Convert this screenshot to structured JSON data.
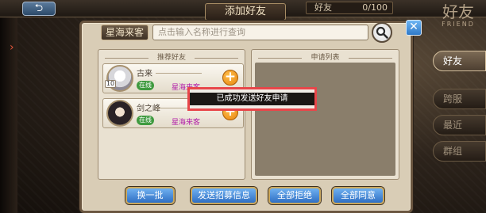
{
  "header": {
    "back_icon": "back-arrow-icon",
    "title": "添加好友",
    "friend_count_label": "好友",
    "friend_count_value": "0/100",
    "brand_cn": "好友",
    "brand_en": "FRIEND"
  },
  "side_tabs": [
    {
      "label": "好友"
    },
    {
      "label": "跨服"
    },
    {
      "label": "最近"
    },
    {
      "label": "群组"
    }
  ],
  "search": {
    "server_label": "星海来客",
    "placeholder": "点击输入名称进行查询"
  },
  "recommend_panel": {
    "header": "推荐好友"
  },
  "request_panel": {
    "header": "申请列表"
  },
  "friends": [
    {
      "name": "古来",
      "level": "10",
      "status": "在线",
      "server": "星海来客"
    },
    {
      "name": "剑之峰",
      "level": "",
      "status": "在线",
      "server": "星海来客"
    }
  ],
  "toast": {
    "message": "已成功发送好友申请"
  },
  "buttons": {
    "refresh": "换一批",
    "send_recruit": "发送招募信息",
    "reject_all": "全部拒绝",
    "accept_all": "全部同意"
  },
  "colors": {
    "accent_blue": "#2f79c8",
    "online_green": "#3f9a3f",
    "server_magenta": "#b11aa7",
    "toast_border": "#e8464a"
  }
}
